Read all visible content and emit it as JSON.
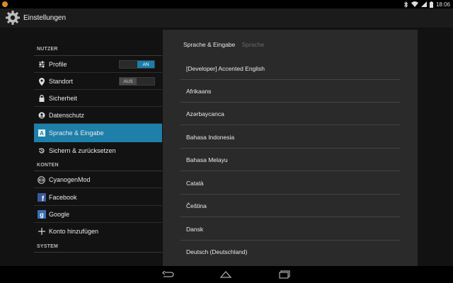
{
  "status_bar": {
    "time": "18:06",
    "icons": [
      "notification-dot-icon",
      "bluetooth-icon",
      "wifi-icon",
      "signal-icon",
      "battery-icon"
    ]
  },
  "action_bar": {
    "title": "Einstellungen",
    "icon": "settings-gear-icon"
  },
  "left_pane": {
    "categories": {
      "nutzer": "NUTZER",
      "konten": "KONTEN",
      "system": "SYSTEM"
    },
    "items": [
      {
        "label": "Profile",
        "icon": "profile-sliders-icon",
        "toggle": "AN"
      },
      {
        "label": "Standort",
        "icon": "location-pin-icon",
        "toggle": "AUS"
      },
      {
        "label": "Sicherheit",
        "icon": "lock-icon"
      },
      {
        "label": "Datenschutz",
        "icon": "privacy-icon"
      },
      {
        "label": "Sprache & Eingabe",
        "icon": "language-a-icon",
        "selected": true
      },
      {
        "label": "Sichern & zurücksetzen",
        "icon": "backup-restore-icon"
      },
      {
        "label": "CyanogenMod",
        "icon": "cyanogenmod-icon"
      },
      {
        "label": "Facebook",
        "icon": "facebook-icon"
      },
      {
        "label": "Google",
        "icon": "google-icon"
      },
      {
        "label": "Konto hinzufügen",
        "icon": "plus-icon"
      }
    ]
  },
  "right_pane": {
    "breadcrumb": {
      "current": "Sprache & Eingabe",
      "next": "Sprache"
    },
    "languages": [
      "[Developer] Accented English",
      "Afrikaans",
      "Azərbaycanca",
      "Bahasa Indonesia",
      "Bahasa Melayu",
      "Català",
      "Čeština",
      "Dansk",
      "Deutsch (Deutschland)"
    ]
  },
  "nav_bar": {
    "buttons": [
      "back-icon",
      "home-icon",
      "recent-apps-icon"
    ]
  },
  "colors": {
    "accent": "#1e7fa9",
    "background": "#121212",
    "panel": "#2a2a2a",
    "actionbar": "#1b1b1b"
  }
}
